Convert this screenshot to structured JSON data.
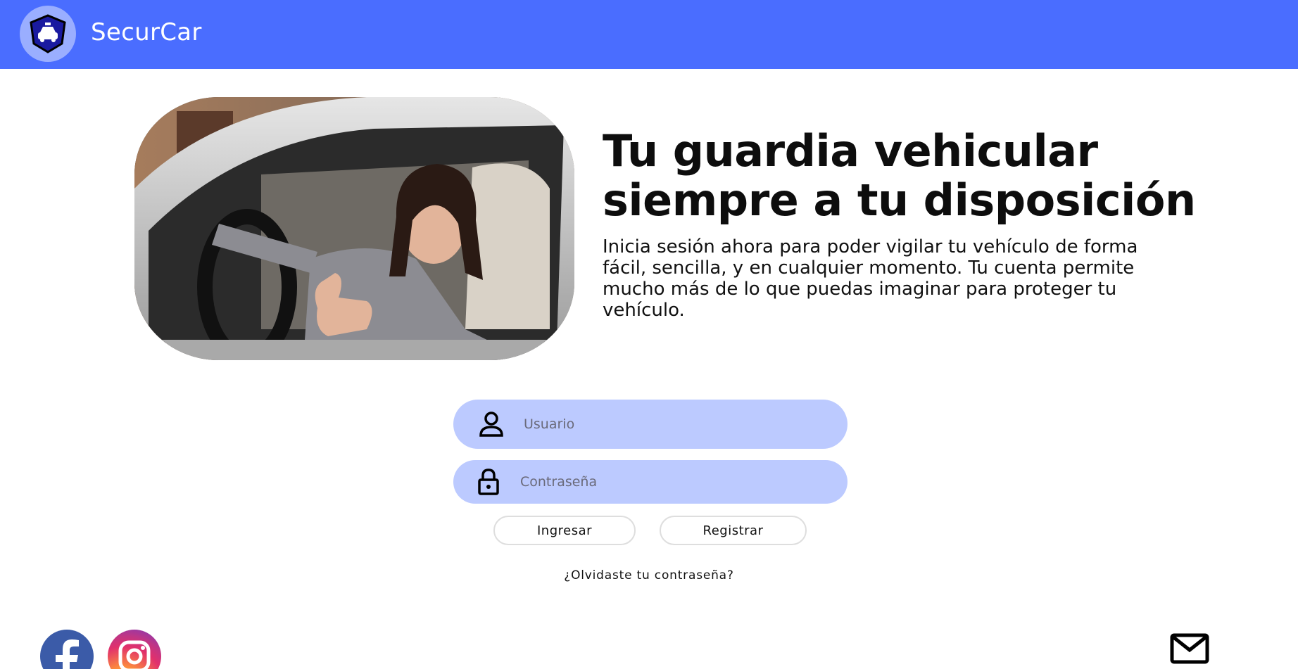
{
  "header": {
    "brand": "SecurCar",
    "logo_icon": "shield-car-icon",
    "colors": {
      "bar": "#4a6dff",
      "badge": "#9aaeff"
    }
  },
  "hero": {
    "image_alt": "woman-in-car-thumbs-up-photo",
    "headline": "Tu guardia vehicular siempre a tu disposición",
    "subtext": "Inicia sesión ahora para poder vigilar tu vehículo de forma fácil, sencilla, y en cualquier momento. Tu cuenta permite mucho más de lo que puedas imaginar para proteger tu vehículo."
  },
  "login": {
    "username": {
      "placeholder": "Usuario",
      "value": "",
      "icon": "user-icon"
    },
    "password": {
      "placeholder": "Contraseña",
      "value": "",
      "icon": "lock-icon"
    },
    "login_label": "Ingresar",
    "register_label": "Registrar",
    "forgot_label": "¿Olvidaste tu contraseña?",
    "field_color": "#bccaff"
  },
  "footer": {
    "social": [
      {
        "name": "facebook",
        "icon": "facebook-icon",
        "color": "#3b5ba8"
      },
      {
        "name": "instagram",
        "icon": "instagram-icon"
      }
    ],
    "mail_icon": "mail-icon"
  }
}
